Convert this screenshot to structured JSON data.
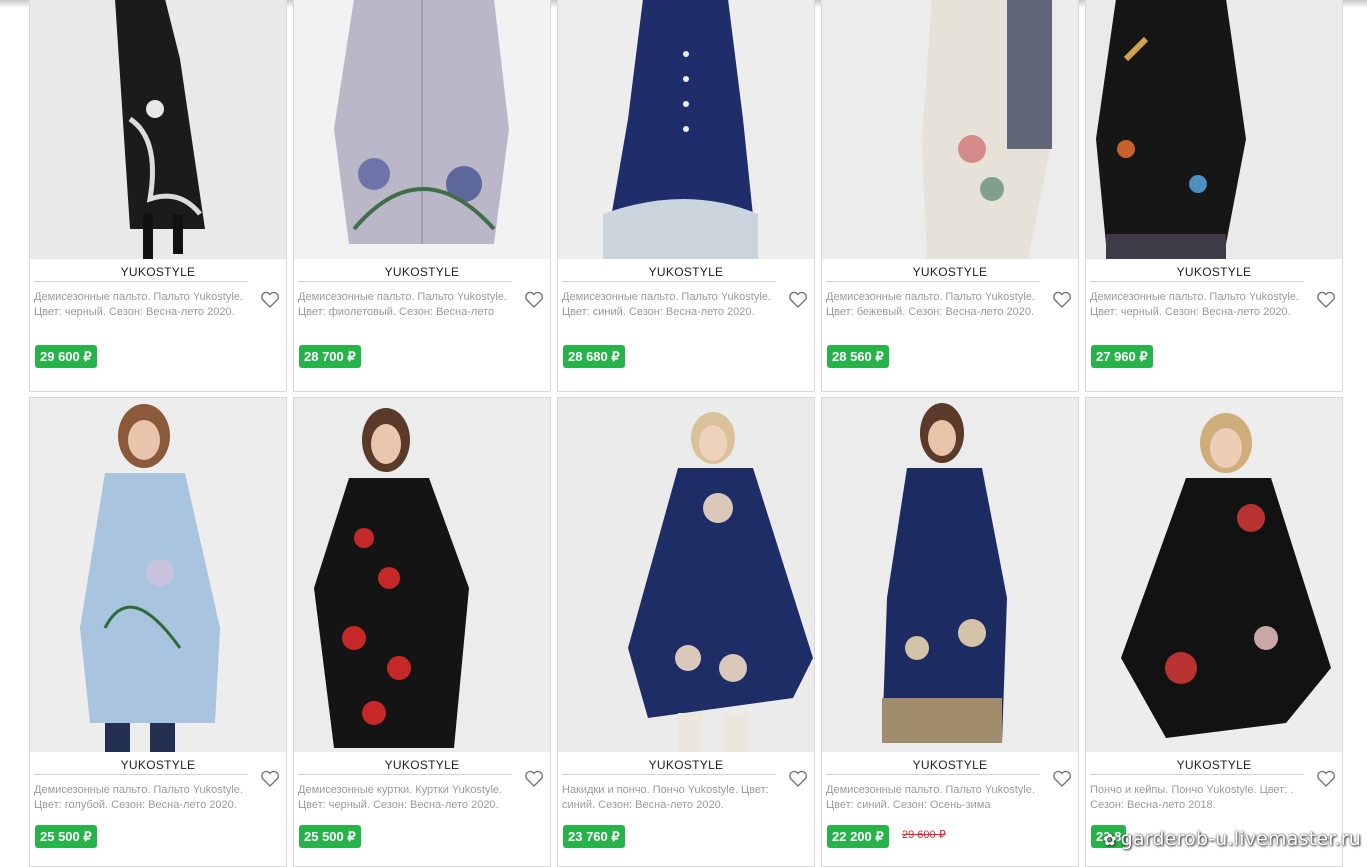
{
  "products": [
    {
      "brand": "YUKOSTYLE",
      "desc": "Демисезонные пальто. Пальто Yukostyle. Цвет: черный. Сезон: Весна-лето 2020.",
      "price": "29 600 ₽",
      "old_price": "",
      "coat_color": "#1b1b1b",
      "bg": "#e9e9e9"
    },
    {
      "brand": "YUKOSTYLE",
      "desc": "Демисезонные пальто. Пальто Yukostyle. Цвет: фиолетовый. Сезон: Весна-лето",
      "price": "28 700 ₽",
      "old_price": "",
      "coat_color": "#b9b7c8",
      "bg": "#f2f2f2"
    },
    {
      "brand": "YUKOSTYLE",
      "desc": "Демисезонные пальто. Пальто Yukostyle. Цвет: синий. Сезон: Весна-лето 2020.",
      "price": "28 680 ₽",
      "old_price": "",
      "coat_color": "#1f2e6b",
      "bg": "#ededed"
    },
    {
      "brand": "YUKOSTYLE",
      "desc": "Демисезонные пальто. Пальто Yukostyle. Цвет: бежевый. Сезон: Весна-лето 2020.",
      "price": "28 560 ₽",
      "old_price": "",
      "coat_color": "#e6e2d8",
      "bg": "#ececec"
    },
    {
      "brand": "YUKOSTYLE",
      "desc": "Демисезонные пальто. Пальто Yukostyle. Цвет: черный. Сезон: Весна-лето 2020.",
      "price": "27 960 ₽",
      "old_price": "",
      "coat_color": "#161616",
      "bg": "#eaeaea"
    },
    {
      "brand": "YUKOSTYLE",
      "desc": "Демисезонные пальто. Пальто Yukostyle. Цвет: голубой. Сезон: Весна-лето 2020.",
      "price": "25 500 ₽",
      "old_price": "",
      "coat_color": "#a9c4de",
      "bg": "#ededed"
    },
    {
      "brand": "YUKOSTYLE",
      "desc": "Демисезонные куртки. Куртки Yukostyle. Цвет: черный. Сезон: Весна-лето 2020.",
      "price": "25 500 ₽",
      "old_price": "",
      "coat_color": "#141414",
      "bg": "#ececec"
    },
    {
      "brand": "YUKOSTYLE",
      "desc": "Накидки и пончо. Пончо Yukostyle. Цвет: синий. Сезон: Весна-лето 2020.",
      "price": "23 760 ₽",
      "old_price": "",
      "coat_color": "#1f2d66",
      "bg": "#ebebeb"
    },
    {
      "brand": "YUKOSTYLE",
      "desc": "Демисезонные пальто. Пальто Yukostyle. Цвет: синий. Сезон: Осень-зима",
      "price": "22 200 ₽",
      "old_price": "29 600 ₽",
      "coat_color": "#1d2b63",
      "bg": "#ececec"
    },
    {
      "brand": "YUKOSTYLE",
      "desc": "Пончо и кейпы. Пончо Yukostyle. Цвет: . Сезон: Весна-лето 2018.",
      "price": "23 8",
      "old_price": "",
      "coat_color": "#121212",
      "bg": "#ededed"
    }
  ],
  "watermark": "garderob-u.livemaster.ru",
  "colors": {
    "price_bg": "#27b34a",
    "old_price": "#e0262c",
    "border": "#d9d9d9"
  },
  "icons": {
    "wishlist": "heart-outline-icon",
    "watermark": "flower-icon"
  }
}
